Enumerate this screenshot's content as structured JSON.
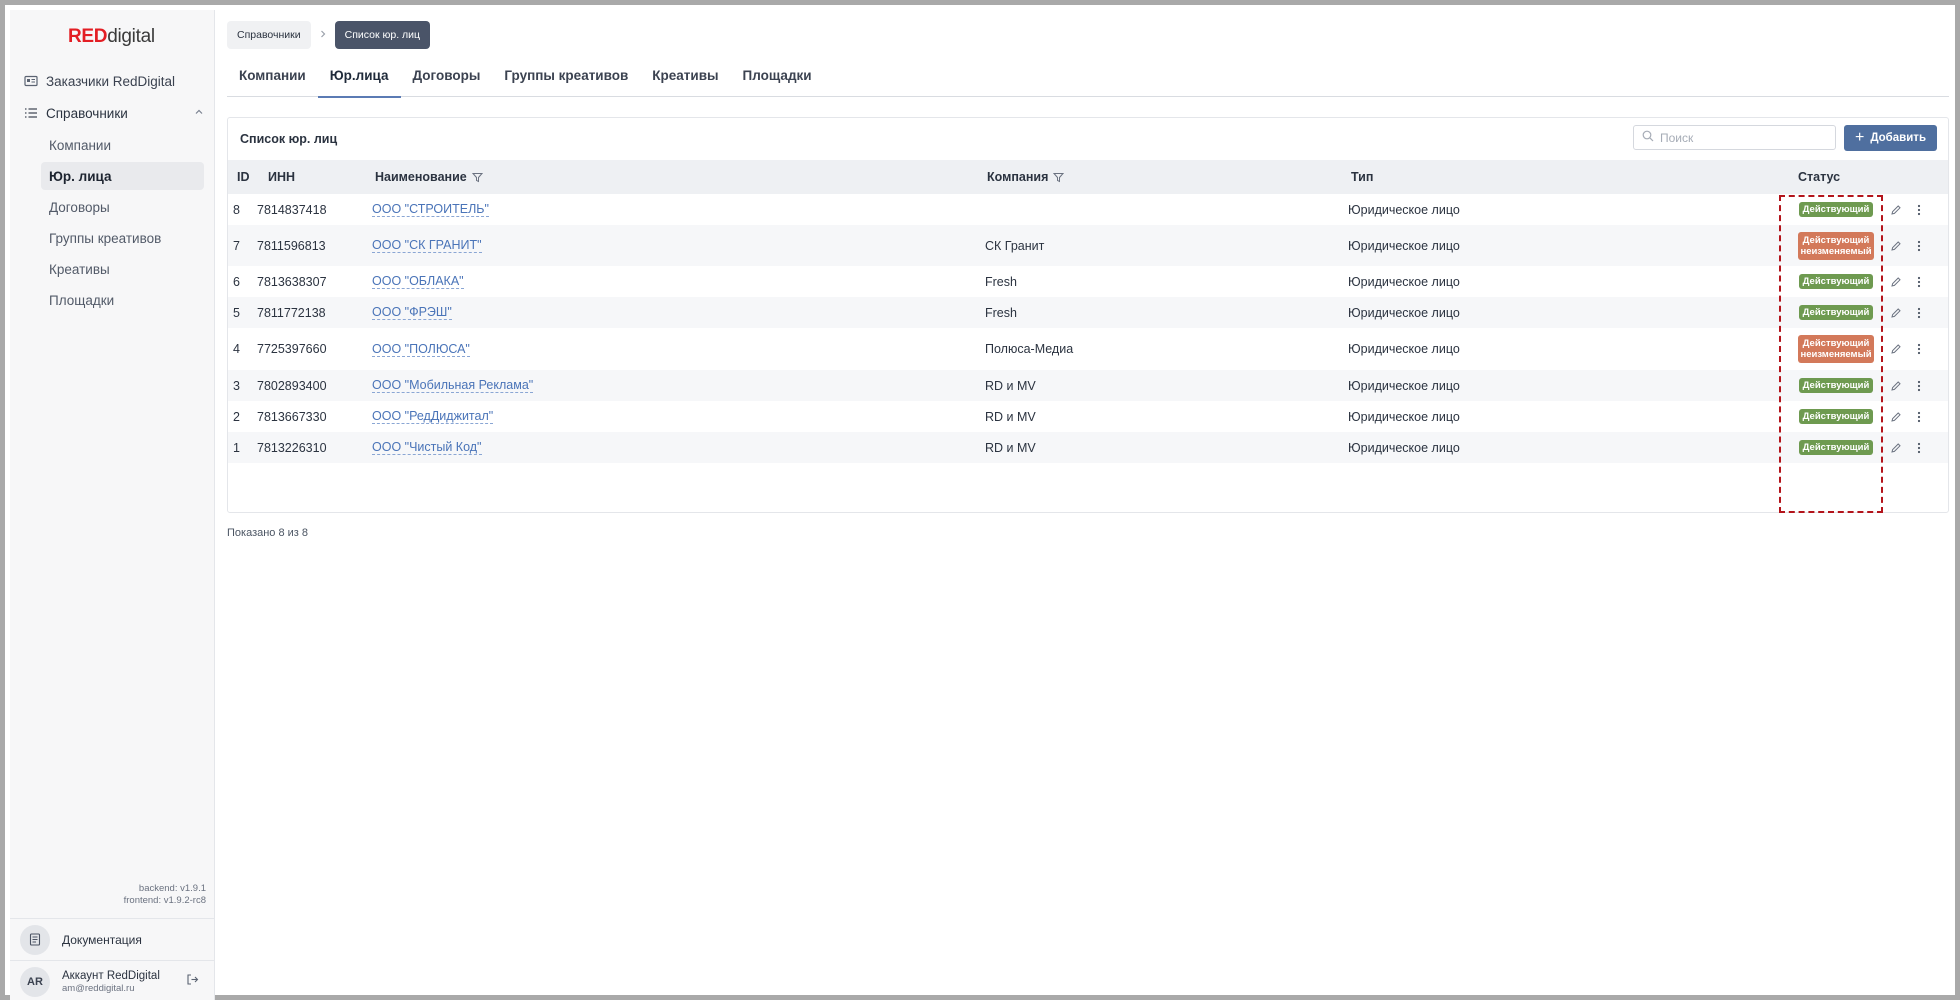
{
  "brand": {
    "red": "RED",
    "rest": "digital"
  },
  "sidebar": {
    "top_item": "Заказчики RedDigital",
    "group_label": "Справочники",
    "items": [
      {
        "label": "Компании",
        "active": false
      },
      {
        "label": "Юр. лица",
        "active": true
      },
      {
        "label": "Договоры",
        "active": false
      },
      {
        "label": "Группы креативов",
        "active": false
      },
      {
        "label": "Креативы",
        "active": false
      },
      {
        "label": "Площадки",
        "active": false
      }
    ],
    "versions": {
      "backend": "backend: v1.9.1",
      "frontend": "frontend: v1.9.2-rc8"
    },
    "docs_label": "Документация",
    "account": {
      "initials": "AR",
      "name": "Аккаунт RedDigital",
      "email": "am@reddigital.ru"
    }
  },
  "breadcrumb": {
    "parent": "Справочники",
    "current": "Список юр. лиц"
  },
  "tabs": [
    {
      "label": "Компании",
      "active": false
    },
    {
      "label": "Юр.лица",
      "active": true
    },
    {
      "label": "Договоры",
      "active": false
    },
    {
      "label": "Группы креативов",
      "active": false
    },
    {
      "label": "Креативы",
      "active": false
    },
    {
      "label": "Площадки",
      "active": false
    }
  ],
  "panel": {
    "title": "Список юр. лиц",
    "search_placeholder": "Поиск",
    "add_label": "Добавить"
  },
  "table": {
    "columns": {
      "id": "ID",
      "inn": "ИНН",
      "name": "Наименование",
      "company": "Компания",
      "type": "Тип",
      "status": "Статус"
    },
    "rows": [
      {
        "id": "8",
        "inn": "7814837418",
        "name": "ООО \"СТРОИТЕЛЬ\"",
        "company": "",
        "type": "Юридическое лицо",
        "status": "Действующий",
        "status_kind": "green"
      },
      {
        "id": "7",
        "inn": "7811596813",
        "name": "ООО \"СК ГРАНИТ\"",
        "company": "СК Гранит",
        "type": "Юридическое лицо",
        "status": "Действующий неизменяемый",
        "status_kind": "orange"
      },
      {
        "id": "6",
        "inn": "7813638307",
        "name": "ООО \"ОБЛАКА\"",
        "company": "Fresh",
        "type": "Юридическое лицо",
        "status": "Действующий",
        "status_kind": "green"
      },
      {
        "id": "5",
        "inn": "7811772138",
        "name": "ООО \"ФРЭШ\"",
        "company": "Fresh",
        "type": "Юридическое лицо",
        "status": "Действующий",
        "status_kind": "green"
      },
      {
        "id": "4",
        "inn": "7725397660",
        "name": "ООО \"ПОЛЮСА\"",
        "company": "Полюса-Медиа",
        "type": "Юридическое лицо",
        "status": "Действующий неизменяемый",
        "status_kind": "orange"
      },
      {
        "id": "3",
        "inn": "7802893400",
        "name": "ООО \"Мобильная Реклама\"",
        "company": "RD и MV",
        "type": "Юридическое лицо",
        "status": "Действующий",
        "status_kind": "green"
      },
      {
        "id": "2",
        "inn": "7813667330",
        "name": "ООО \"РедДиджитал\"",
        "company": "RD и MV",
        "type": "Юридическое лицо",
        "status": "Действующий",
        "status_kind": "green"
      },
      {
        "id": "1",
        "inn": "7813226310",
        "name": "ООО \"Чистый Код\"",
        "company": "RD и MV",
        "type": "Юридическое лицо",
        "status": "Действующий",
        "status_kind": "green"
      }
    ]
  },
  "footer_count": "Показано 8 из 8",
  "icons": {
    "top_item": "id-card-icon",
    "group": "list-icon",
    "chevron": "chevron-up-icon",
    "docs": "document-icon",
    "logout": "logout-icon",
    "search": "search-icon",
    "add": "plus-icon",
    "filter": "filter-icon",
    "edit": "pencil-icon",
    "more": "more-vertical-icon"
  },
  "colors": {
    "brand_red": "#e31e24",
    "primary": "#4f6f9f",
    "status_active": "#6e9a50",
    "status_immutable": "#d3795a",
    "highlight": "#b3141b"
  }
}
